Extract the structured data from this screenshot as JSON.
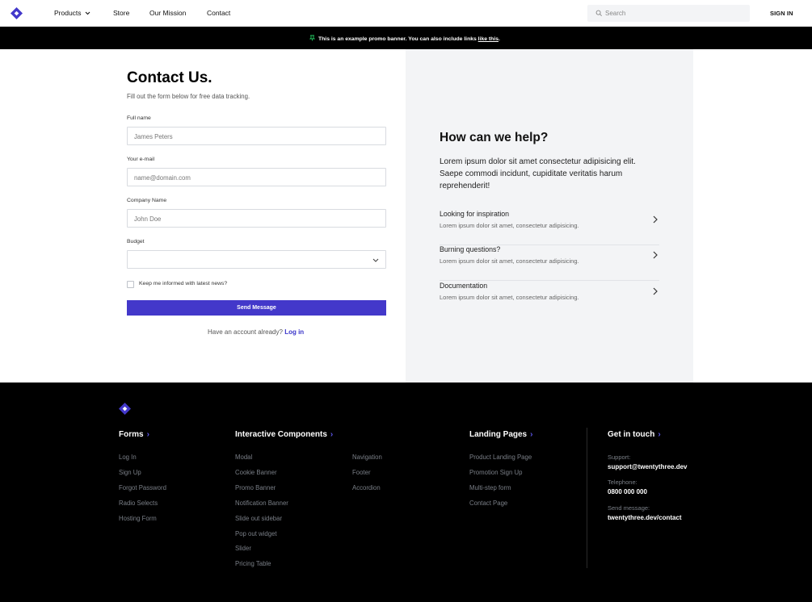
{
  "nav": {
    "products_label": "Products",
    "store_label": "Store",
    "mission_label": "Our Mission",
    "contact_label": "Contact",
    "search_placeholder": "Search",
    "signin_label": "SIGN IN",
    "brand_color": "#4338ca"
  },
  "promo": {
    "text": "This is an example promo banner. You can also include links ",
    "link_text": "like this",
    "suffix": ".",
    "pin_color": "#22c55e"
  },
  "contact": {
    "title": "Contact Us.",
    "subtitle": "Fill out the form below for free data tracking.",
    "fullname_label": "Full name",
    "fullname_placeholder": "James Peters",
    "email_label": "Your e-mail",
    "email_placeholder": "name@domain.com",
    "company_label": "Company Name",
    "company_placeholder": "John Doe",
    "budget_label": "Budget",
    "budget_value": "",
    "checkbox_label": "Keep me informed with latest news?",
    "send_label": "Send Message",
    "account_text": "Have an account already?",
    "login_link": "Log in"
  },
  "help": {
    "title": "How can we help?",
    "description": "Lorem ipsum dolor sit amet consectetur adipisicing elit. Saepe commodi incidunt, cupiditate veritatis harum reprehenderit!",
    "items": [
      {
        "title": "Looking for inspiration",
        "desc": "Lorem ipsum dolor sit amet, consectetur adipisicing."
      },
      {
        "title": "Burning questions?",
        "desc": "Lorem ipsum dolor sit amet, consectetur adipisicing."
      },
      {
        "title": "Documentation",
        "desc": "Lorem ipsum dolor sit amet, consectetur adipisicing."
      }
    ]
  },
  "footer": {
    "forms": {
      "heading": "Forms",
      "links": [
        "Log In",
        "Sign Up",
        "Forgot Password",
        "Radio Selects",
        "Hosting Form"
      ]
    },
    "interactive": {
      "heading": "Interactive Components",
      "links_col1": [
        "Modal",
        "Cookie Banner",
        "Promo Banner",
        "Notification Banner",
        "Slide out sidebar",
        "Pop out widget",
        "Slider",
        "Pricing Table"
      ],
      "links_col2": [
        "Navigation",
        "Footer",
        "Accordion"
      ]
    },
    "landing": {
      "heading": "Landing Pages",
      "links": [
        "Product Landing Page",
        "Promotion Sign Up",
        "Multi-step form",
        "Contact Page"
      ]
    },
    "touch": {
      "heading": "Get in touch",
      "support_label": "Support:",
      "support_value": "support@twentythree.dev",
      "telephone_label": "Telephone:",
      "telephone_value": "0800 000 000",
      "message_label": "Send message:",
      "message_value": "twentythree.dev/contact"
    },
    "accent_color": "#5b55e8"
  }
}
